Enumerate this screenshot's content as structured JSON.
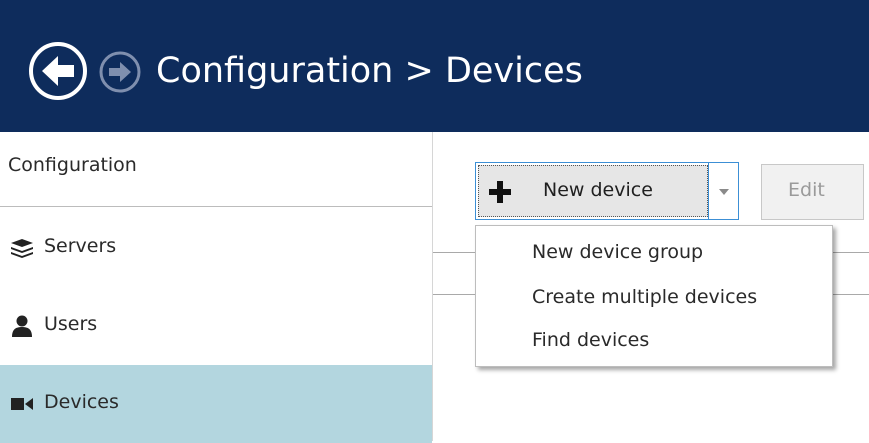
{
  "header": {
    "title": "Configuration > Devices",
    "back_icon": "back-arrow-circle-icon",
    "forward_icon": "forward-arrow-circle-icon",
    "background": "#0e2c5c"
  },
  "sidebar": {
    "header": "Configuration",
    "items": [
      {
        "label": "Servers",
        "icon": "stack-layers-icon",
        "active": false
      },
      {
        "label": "Users",
        "icon": "user-icon",
        "active": false
      },
      {
        "label": "Devices",
        "icon": "video-camera-icon",
        "active": true
      }
    ],
    "active_color": "#b3d6df"
  },
  "toolbar": {
    "new_device_label": "New device",
    "edit_label": "Edit"
  },
  "dropdown_menu": {
    "items": [
      "New device group",
      "Create multiple devices",
      "Find devices"
    ]
  }
}
